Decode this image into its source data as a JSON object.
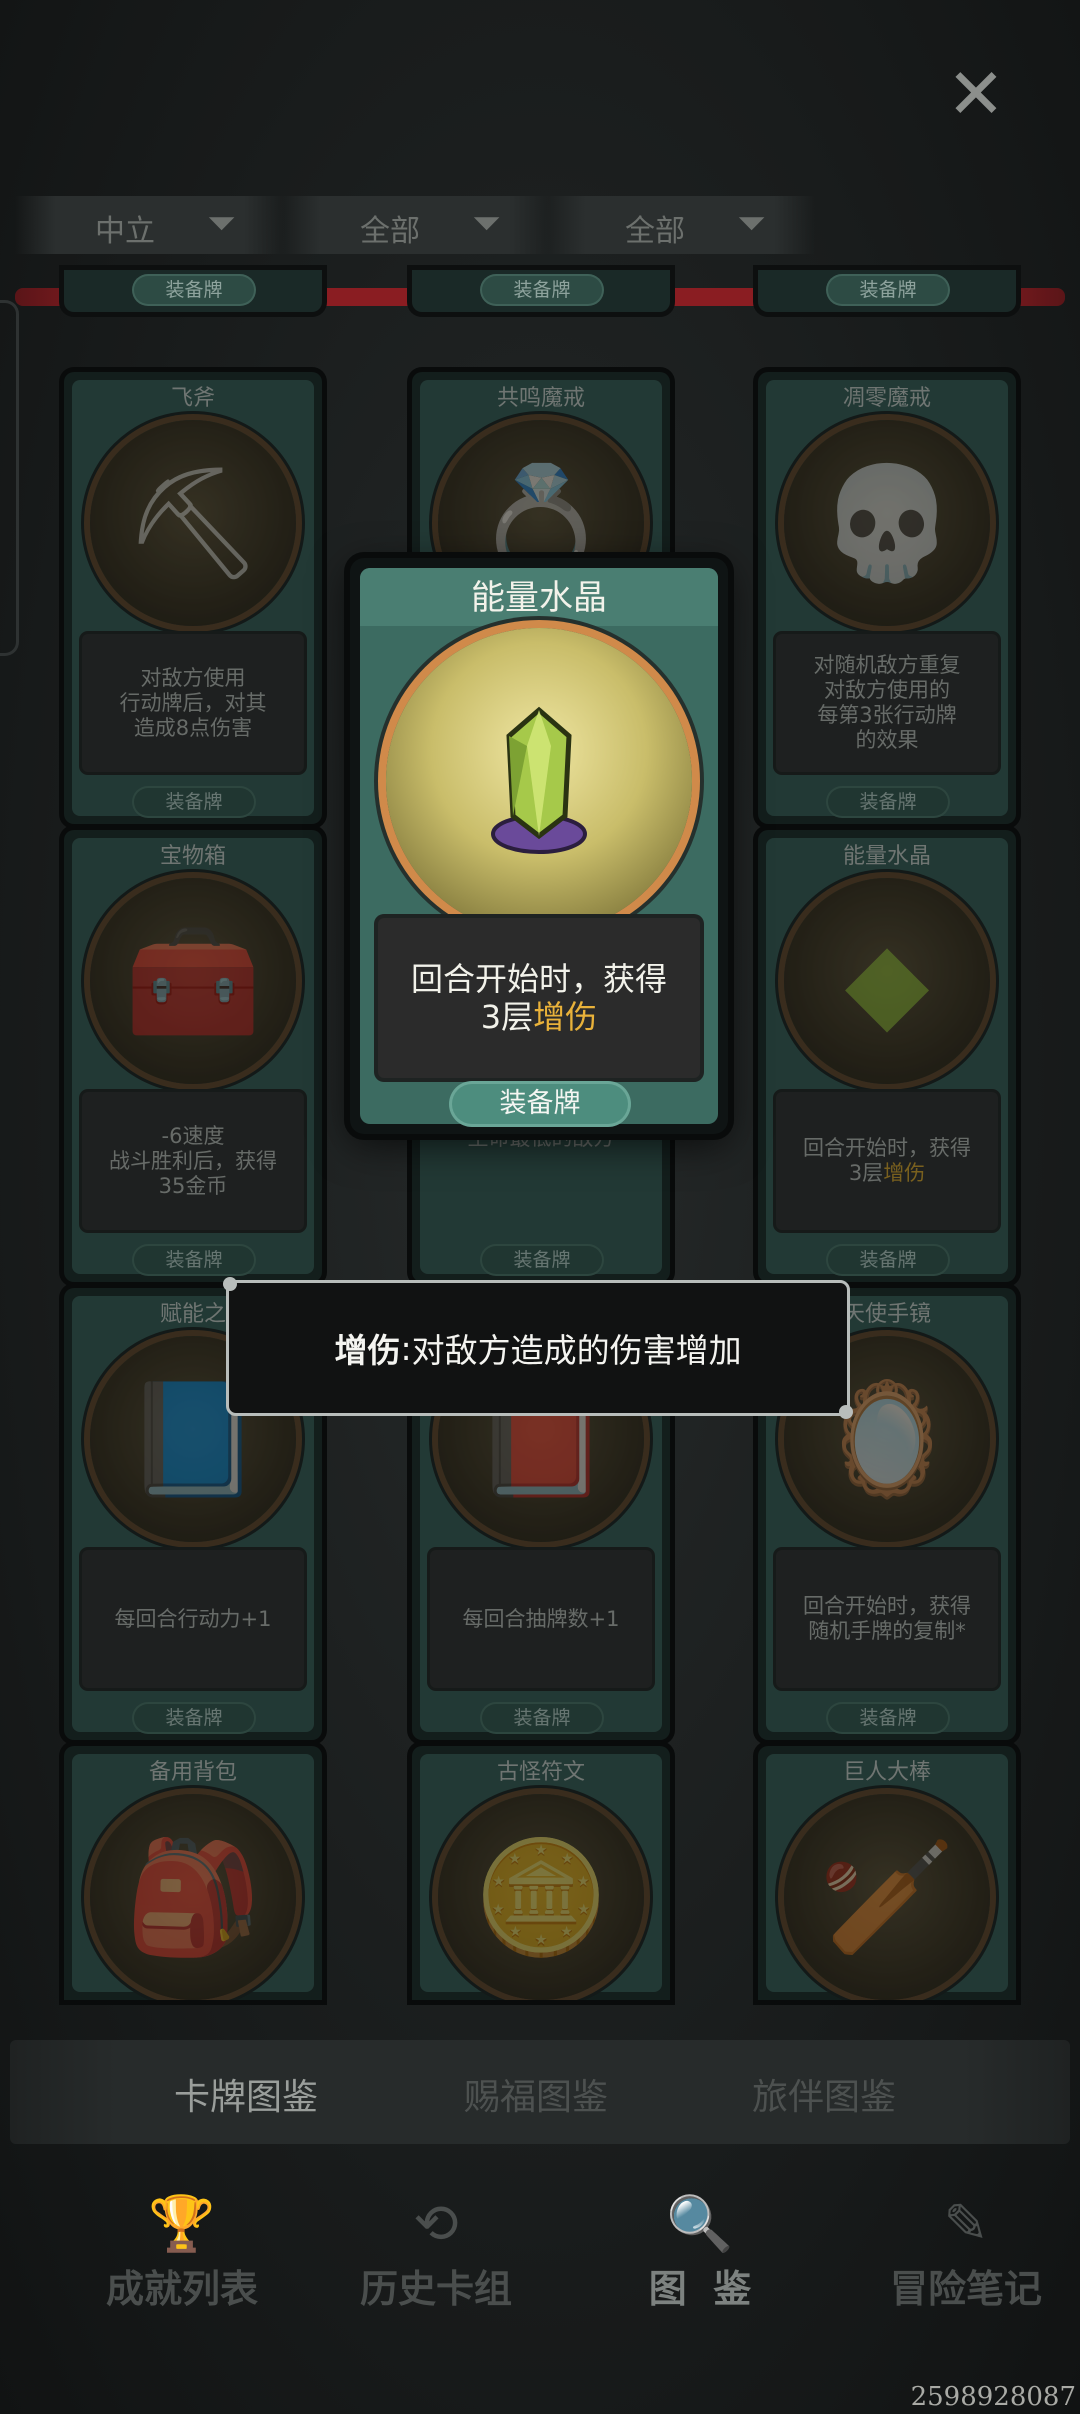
{
  "filters": [
    {
      "label": "中立",
      "icon": "funnel-icon"
    },
    {
      "label": "全部",
      "icon": "funnel-icon"
    },
    {
      "label": "全部",
      "icon": "funnel-icon"
    }
  ],
  "top_row_badges": [
    "装备牌",
    "装备牌",
    "装备牌"
  ],
  "cards": [
    {
      "title": "飞斧",
      "desc": "对敌方使用\n行动牌后，对其\n造成8点伤害",
      "badge": "装备牌",
      "icon": "axe-icon"
    },
    {
      "title": "共鸣魔戒",
      "desc": "",
      "badge": "",
      "icon": "ring-icon"
    },
    {
      "title": "凋零魔戒",
      "desc": "对随机敌方重复\n对敌方使用的\n每第3张行动牌\n的效果",
      "badge": "装备牌",
      "icon": "skull-ring-icon"
    },
    {
      "title": "宝物箱",
      "desc": "-6速度\n战斗胜利后，获得\n35金币",
      "badge": "装备牌",
      "icon": "chest-icon"
    },
    {
      "title": "",
      "desc": "生命最低的敌方",
      "badge": "装备牌",
      "icon": "card-icon"
    },
    {
      "title": "能量水晶",
      "desc_pre": "回合开始时，获得\n3层",
      "desc_hl": "增伤",
      "badge": "装备牌",
      "icon": "crystal-icon"
    },
    {
      "title": "赋能之",
      "desc": "每回合行动力+1",
      "badge": "装备牌",
      "icon": "book-icon"
    },
    {
      "title": "",
      "desc": "每回合抽牌数+1",
      "badge": "装备牌",
      "icon": "tome-icon"
    },
    {
      "title": "天使手镜",
      "desc": "回合开始时，获得\n随机手牌的复制*",
      "badge": "装备牌",
      "icon": "mirror-icon"
    },
    {
      "title": "备用背包",
      "desc": "",
      "badge": "",
      "icon": "backpack-icon"
    },
    {
      "title": "古怪符文",
      "desc": "",
      "badge": "",
      "icon": "rune-icon"
    },
    {
      "title": "巨人大棒",
      "desc": "",
      "badge": "",
      "icon": "club-icon"
    }
  ],
  "popup": {
    "title": "能量水晶",
    "desc_line1": "回合开始时，获得",
    "desc_line2_pre": "3层",
    "desc_line2_hl": "增伤",
    "badge": "装备牌"
  },
  "tooltip": {
    "term": "增伤",
    "sep": ": ",
    "text": "对敌方造成的伤害增加"
  },
  "tabs": [
    "卡牌图鉴",
    "赐福图鉴",
    "旅伴图鉴"
  ],
  "nav": [
    {
      "label": "成就列表",
      "icon": "trophy-icon",
      "glyph": "🏆"
    },
    {
      "label": "历史卡组",
      "icon": "history-icon",
      "glyph": "⟲"
    },
    {
      "label": "图  鉴",
      "icon": "magnifier-icon",
      "glyph": "🔍"
    },
    {
      "label": "冒险笔记",
      "icon": "notebook-icon",
      "glyph": "✎"
    }
  ],
  "footer_id": "2598928087",
  "colors": {
    "highlight": "#e9b23a",
    "card_green": "#3c6b61",
    "tooltip_border": "#b8bdbb"
  }
}
